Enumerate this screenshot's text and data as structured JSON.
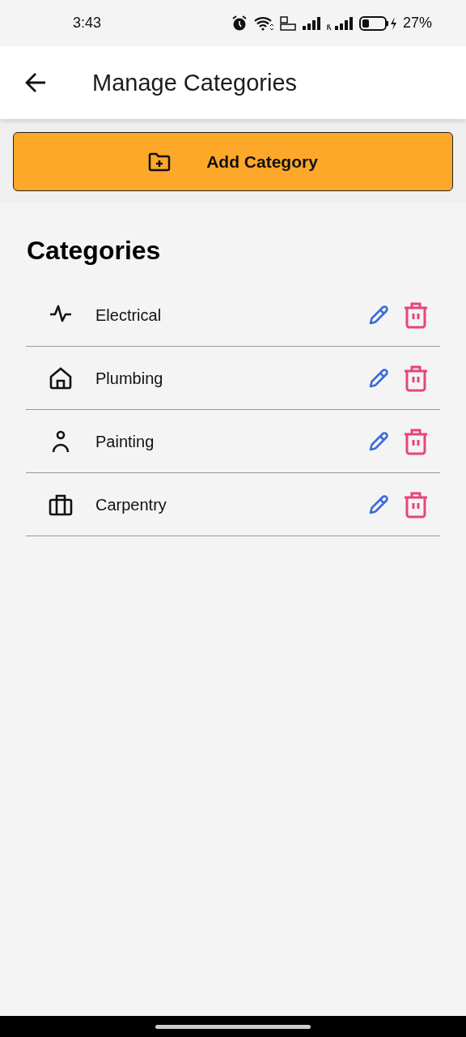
{
  "status_bar": {
    "time": "3:43",
    "battery": "27%"
  },
  "app_bar": {
    "title": "Manage Categories"
  },
  "add_button": {
    "label": "Add Category"
  },
  "section_title": "Categories",
  "categories": [
    {
      "name": "Electrical"
    },
    {
      "name": "Plumbing"
    },
    {
      "name": "Painting"
    },
    {
      "name": "Carpentry"
    }
  ]
}
